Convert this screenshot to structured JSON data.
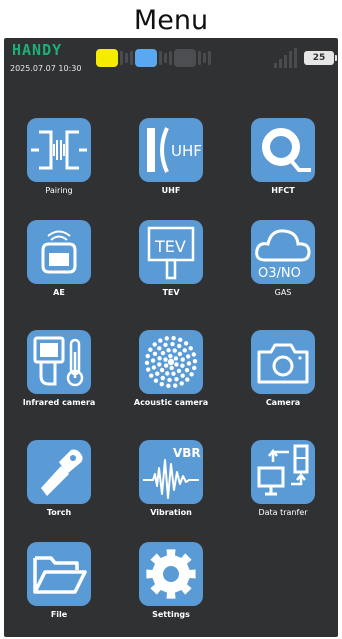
{
  "page": {
    "heading": "Menu"
  },
  "status_bar": {
    "brand": "HANDY",
    "datetime": "2025.07.07 10:30",
    "channels": [
      {
        "name": "channel-1",
        "color": "#f5ec00"
      },
      {
        "name": "channel-2",
        "color": "#5aa8f2"
      },
      {
        "name": "channel-3",
        "color": "#4d4e51"
      }
    ],
    "battery": "25"
  },
  "colors": {
    "background": "#303133",
    "tile": "#5b9bd5",
    "brand": "#1fae74"
  },
  "menu": [
    {
      "label": "Pairing",
      "icon": "pairing-icon"
    },
    {
      "label": "UHF",
      "icon": "uhf-icon"
    },
    {
      "label": "HFCT",
      "icon": "hfct-icon"
    },
    {
      "label": "AE",
      "icon": "ae-sensor-icon"
    },
    {
      "label": "TEV",
      "icon": "tev-icon"
    },
    {
      "label": "GAS",
      "icon": "gas-cloud-icon",
      "icon_text": "O3/NO"
    },
    {
      "label": "Infrared camera",
      "icon": "infrared-camera-icon"
    },
    {
      "label": "Acoustic camera",
      "icon": "acoustic-camera-icon"
    },
    {
      "label": "Camera",
      "icon": "camera-icon"
    },
    {
      "label": "Torch",
      "icon": "torch-icon"
    },
    {
      "label": "Vibration",
      "icon": "vibration-icon",
      "icon_text": "VBR"
    },
    {
      "label": "Data tranfer",
      "icon": "data-transfer-icon"
    },
    {
      "label": "File",
      "icon": "folder-icon"
    },
    {
      "label": "Settings",
      "icon": "gear-icon"
    }
  ]
}
